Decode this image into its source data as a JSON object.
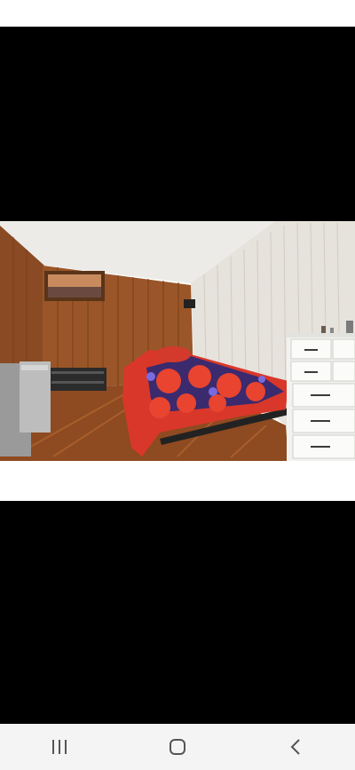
{
  "photo": {
    "description_icon": "bedroom-photo"
  },
  "nav": {
    "recents_icon": "recent-apps-icon",
    "home_icon": "home-icon",
    "back_icon": "back-icon"
  }
}
